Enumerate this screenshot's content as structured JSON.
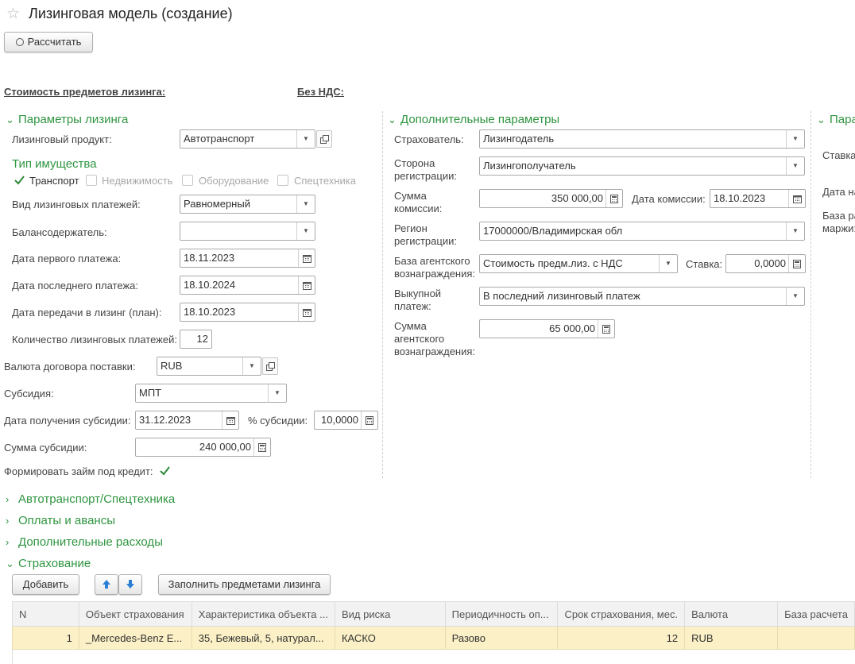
{
  "window": {
    "title": "Лизинговая модель (создание)"
  },
  "toolbar": {
    "calculate_label": "Рассчитать"
  },
  "summary": {
    "cost_label": "Стоимость предметов лизинга:",
    "no_vat_label": "Без НДС:"
  },
  "leasing_params": {
    "header": "Параметры лизинга",
    "product_label": "Лизинговый продукт:",
    "product_value": "Автотранспорт",
    "property_type_header": "Тип имущества",
    "property_types": [
      {
        "label": "Транспорт",
        "checked": true,
        "enabled": true
      },
      {
        "label": "Недвижимость",
        "checked": false,
        "enabled": false
      },
      {
        "label": "Оборудование",
        "checked": false,
        "enabled": false
      },
      {
        "label": "Спецтехника",
        "checked": false,
        "enabled": false
      }
    ],
    "payment_kind_label": "Вид лизинговых платежей:",
    "payment_kind_value": "Равномерный",
    "balance_holder_label": "Балансодержатель:",
    "balance_holder_value": "",
    "first_payment_label": "Дата первого платежа:",
    "first_payment_value": "18.11.2023",
    "last_payment_label": "Дата последнего платежа:",
    "last_payment_value": "18.10.2024",
    "transfer_date_label": "Дата передачи в лизинг (план):",
    "transfer_date_value": "18.10.2023",
    "payments_count_label": "Количество лизинговых платежей:",
    "payments_count_value": "12",
    "currency_label": "Валюта договора поставки:",
    "currency_value": "RUB",
    "subsidy_label": "Субсидия:",
    "subsidy_value": "МПТ",
    "subsidy_date_label": "Дата получения субсидии:",
    "subsidy_date_value": "31.12.2023",
    "subsidy_pct_label": "% субсидии:",
    "subsidy_pct_value": "10,0000",
    "subsidy_sum_label": "Сумма субсидии:",
    "subsidy_sum_value": "240 000,00",
    "loan_label": "Формировать займ под кредит:",
    "loan_checked": true
  },
  "extra_params": {
    "header": "Дополнительные параметры",
    "insurer_label": "Страхователь:",
    "insurer_value": "Лизингодатель",
    "reg_side_label": "Сторона регистрации:",
    "reg_side_value": "Лизингополучатель",
    "commission_label": "Сумма комиссии:",
    "commission_value": "350 000,00",
    "commission_date_label": "Дата комиссии:",
    "commission_date_value": "18.10.2023",
    "region_label": "Регион регистрации:",
    "region_value": "17000000/Владимирская обл",
    "agent_base_label": "База агентского вознаграждения:",
    "agent_base_value": "Стоимость предм.лиз. с НДС",
    "rate_label": "Ставка:",
    "rate_value": "0,0000",
    "buyout_label": "Выкупной платеж:",
    "buyout_value": "В последний лизинговый платеж",
    "agent_sum_label": "Сумма агентского вознаграждения:",
    "agent_sum_value": "65 000,00"
  },
  "third_column": {
    "header": "Пара",
    "rate_label": "Ставка",
    "date_label": "Дата на",
    "base_label_1": "База ра",
    "base_label_2": "маржи:"
  },
  "collapsed_sections": [
    "Автотранспорт/Спецтехника",
    "Оплаты и авансы",
    "Дополнительные расходы"
  ],
  "insurance": {
    "header": "Страхование",
    "add_label": "Добавить",
    "fill_label": "Заполнить предметами лизинга",
    "columns": [
      "N",
      "Объект страхования",
      "Характеристика объекта ...",
      "Вид риска",
      "Периодичность оп...",
      "Срок страхования, мес.",
      "Валюта",
      "База расчета"
    ],
    "rows": [
      [
        "1",
        "_Mercedes-Benz E...",
        "35, Бежевый, 5, натурал...",
        "КАСКО",
        "Разово",
        "12",
        "RUB",
        ""
      ]
    ]
  },
  "icons": [
    "star-icon",
    "dropdown-arrow-icon",
    "open-icon",
    "calendar-icon",
    "calculator-icon",
    "checkmark-icon",
    "chevron-down-icon",
    "chevron-right-icon",
    "arrow-up-icon",
    "arrow-down-icon"
  ],
  "colors": {
    "accent": "#2f9540",
    "row_highlight": "#fbf0c6",
    "arrow_blue": "#2a7fd4"
  }
}
